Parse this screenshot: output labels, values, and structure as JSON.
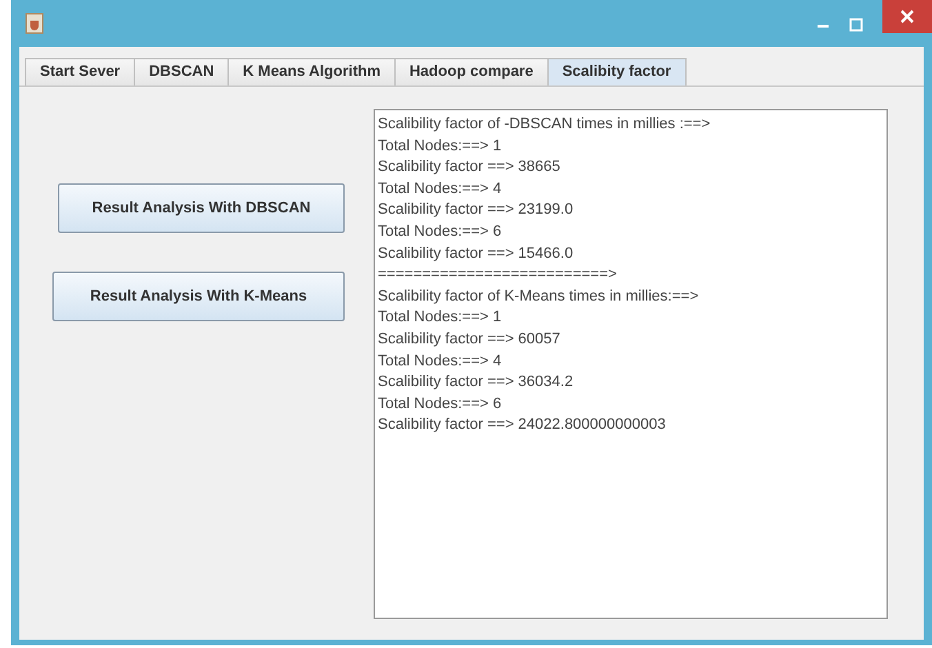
{
  "tabs": [
    {
      "label": "Start Sever",
      "selected": false
    },
    {
      "label": "DBSCAN",
      "selected": false
    },
    {
      "label": "K Means Algorithm",
      "selected": false
    },
    {
      "label": "Hadoop compare",
      "selected": false
    },
    {
      "label": "Scalibity factor",
      "selected": true
    }
  ],
  "buttons": [
    "Result Analysis With DBSCAN",
    "Result Analysis With K-Means"
  ],
  "output_lines": [
    "Scalibility factor of -DBSCAN times in millies :==>",
    "Total Nodes:==> 1",
    "Scalibility factor ==> 38665",
    "Total Nodes:==> 4",
    "Scalibility factor ==> 23199.0",
    "Total Nodes:==> 6",
    "Scalibility factor ==> 15466.0",
    "==========================>",
    "Scalibility factor of K-Means times in millies:==>",
    "Total Nodes:==> 1",
    "Scalibility factor ==> 60057",
    "Total Nodes:==> 4",
    "Scalibility factor ==> 36034.2",
    "Total Nodes:==> 6",
    "Scalibility factor ==> 24022.800000000003"
  ]
}
